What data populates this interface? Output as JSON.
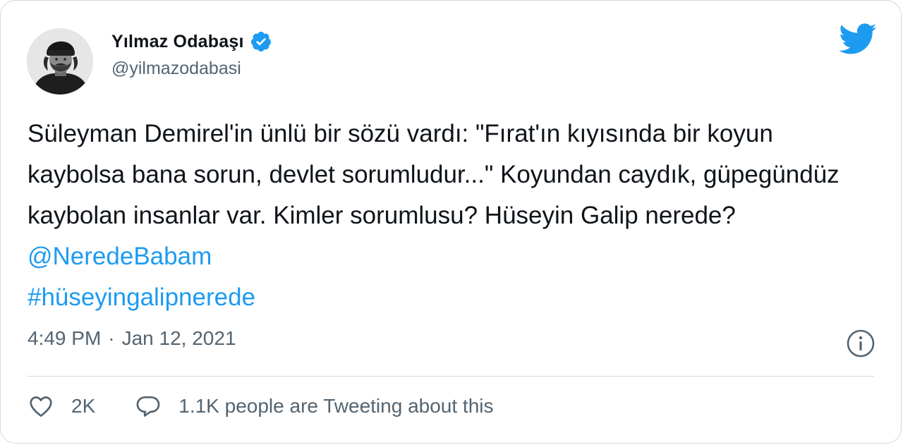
{
  "author": {
    "name": "Yılmaz Odabaşı",
    "handle": "@yilmazodabasi",
    "verified": true,
    "avatar_icon": "avatar-photo"
  },
  "tweet": {
    "text_main": "Süleyman Demirel'in ünlü bir sözü vardı: \"Fırat'ın kıyısında bir koyun kaybolsa bana sorun, devlet sorumludur...\" Koyundan caydık, güpegündüz kaybolan insanlar var. Kimler sorumlusu? Hüseyin Galip nerede?",
    "mention": "@NeredeBabam",
    "hashtag": "#hüseyingalipnerede"
  },
  "meta": {
    "time": "4:49 PM",
    "separator": "·",
    "date": "Jan 12, 2021"
  },
  "actions": {
    "like_count": "2K",
    "conversation_text": "1.1K people are Tweeting about this"
  },
  "icons": {
    "brand": "twitter-bird-icon",
    "verified": "verified-badge-icon",
    "info": "info-icon",
    "like": "heart-icon",
    "reply": "speech-bubble-icon"
  },
  "colors": {
    "brand_blue": "#1d9bf0",
    "text": "#0f1419",
    "secondary": "#536471",
    "border": "#cfd9de"
  }
}
